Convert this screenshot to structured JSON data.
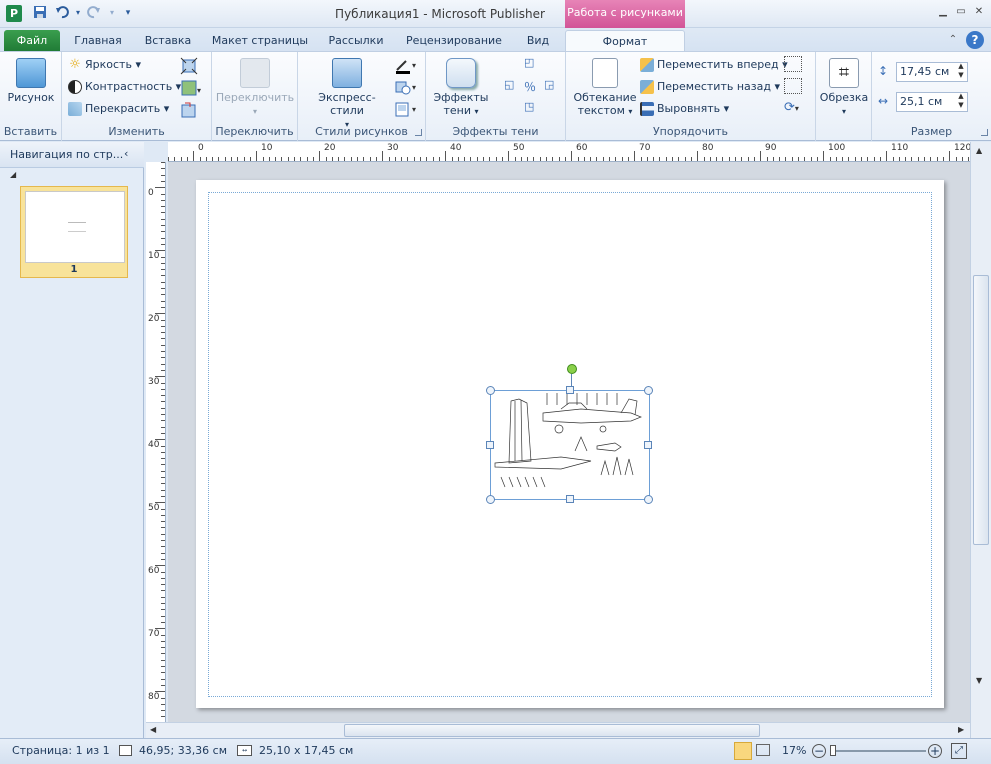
{
  "window": {
    "title": "Публикация1 - Microsoft Publisher",
    "context_tab_header": "Работа с рисунками"
  },
  "qat": {
    "app_icon": "P",
    "save": "save-icon",
    "undo": "undo-icon",
    "redo": "redo-icon"
  },
  "tabs": [
    "Файл",
    "Главная",
    "Вставка",
    "Макет страницы",
    "Рассылки",
    "Рецензирование",
    "Вид",
    "Формат"
  ],
  "ribbon": {
    "insert": {
      "picture": "Рисунок",
      "group": "Вставить"
    },
    "adjust": {
      "brightness": "Яркость",
      "contrast": "Контрастность",
      "recolor": "Перекрасить",
      "group": "Изменить"
    },
    "swap": {
      "swap": "Переключить",
      "group": "Переключить"
    },
    "styles": {
      "quick_styles": "Экспресс-стили",
      "group": "Стили рисунков"
    },
    "shadow": {
      "shadow_effects_1": "Эффекты",
      "shadow_effects_2": "тени",
      "group": "Эффекты тени"
    },
    "arrange": {
      "wrap_1": "Обтекание",
      "wrap_2": "текстом",
      "bring_forward": "Переместить вперед",
      "send_backward": "Переместить назад",
      "align": "Выровнять",
      "group": "Упорядочить"
    },
    "crop": {
      "crop": "Обрезка"
    },
    "size": {
      "height": "17,45 см",
      "width": "25,1 см",
      "group": "Размер"
    }
  },
  "nav": {
    "title": "Навигация по стр...",
    "page_number": "1"
  },
  "hruler_labels": [
    "0",
    "10",
    "20",
    "30",
    "40",
    "50",
    "60",
    "70",
    "80",
    "90",
    "100",
    "110",
    "120"
  ],
  "vruler_labels": [
    "0",
    "10",
    "20",
    "30",
    "40",
    "50",
    "60",
    "70",
    "80"
  ],
  "status": {
    "page": "Страница: 1 из 1",
    "position": "46,95; 33,36 см",
    "size": "25,10 x 17,45 см",
    "zoom": "17%"
  },
  "colors": {
    "file_tab": "#2a8a3f",
    "context_tab": "#d25497",
    "accent": "#1e395b"
  }
}
